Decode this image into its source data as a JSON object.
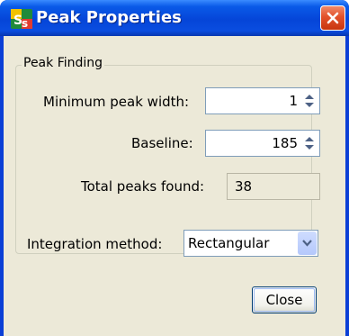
{
  "window": {
    "title": "Peak Properties",
    "app_icon": "app-logo-icon",
    "close_icon": "close-icon"
  },
  "group": {
    "label": "Peak Finding"
  },
  "fields": {
    "min_peak_width_label": "Minimum peak width:",
    "min_peak_width_value": "1",
    "baseline_label": "Baseline:",
    "baseline_value": "185",
    "total_peaks_label": "Total peaks found:",
    "total_peaks_value": "38"
  },
  "integration": {
    "label": "Integration method:",
    "selected": "Rectangular"
  },
  "buttons": {
    "close_label": "Close"
  },
  "colors": {
    "titlebar": "#0545d8",
    "client": "#ece9d8",
    "close_button": "#e2512b"
  }
}
